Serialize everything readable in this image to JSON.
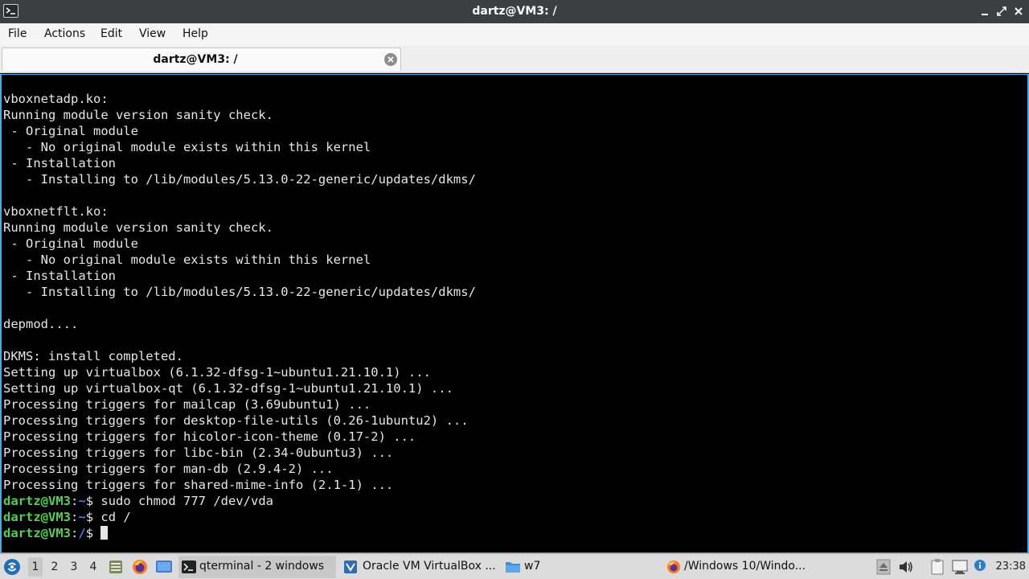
{
  "window": {
    "title": "dartz@VM3: /"
  },
  "menu": {
    "file": "File",
    "actions": "Actions",
    "edit": "Edit",
    "view": "View",
    "help": "Help"
  },
  "tab": {
    "label": "dartz@VM3: /"
  },
  "terminal": {
    "lines": [
      "vboxnetadp.ko:",
      "Running module version sanity check.",
      " - Original module",
      "   - No original module exists within this kernel",
      " - Installation",
      "   - Installing to /lib/modules/5.13.0-22-generic/updates/dkms/",
      "",
      "vboxnetflt.ko:",
      "Running module version sanity check.",
      " - Original module",
      "   - No original module exists within this kernel",
      " - Installation",
      "   - Installing to /lib/modules/5.13.0-22-generic/updates/dkms/",
      "",
      "depmod....",
      "",
      "DKMS: install completed.",
      "Setting up virtualbox (6.1.32-dfsg-1~ubuntu1.21.10.1) ...",
      "Setting up virtualbox-qt (6.1.32-dfsg-1~ubuntu1.21.10.1) ...",
      "Processing triggers for mailcap (3.69ubuntu1) ...",
      "Processing triggers for desktop-file-utils (0.26-1ubuntu2) ...",
      "Processing triggers for hicolor-icon-theme (0.17-2) ...",
      "Processing triggers for libc-bin (2.34-0ubuntu3) ...",
      "Processing triggers for man-db (2.9.4-2) ...",
      "Processing triggers for shared-mime-info (2.1-1) ..."
    ],
    "prompts": [
      {
        "user": "dartz@VM3",
        "colon": ":",
        "path": "~",
        "sym": "$ ",
        "cmd": "sudo chmod 777 /dev/vda"
      },
      {
        "user": "dartz@VM3",
        "colon": ":",
        "path": "~",
        "sym": "$ ",
        "cmd": "cd /"
      },
      {
        "user": "dartz@VM3",
        "colon": ":",
        "path": "/",
        "sym": "$ ",
        "cmd": ""
      }
    ]
  },
  "taskbar": {
    "desktops": [
      "1",
      "2",
      "3",
      "4"
    ],
    "tasks": [
      {
        "label": "qterminal - 2 windows",
        "icon": "terminal-icon"
      },
      {
        "label": "Oracle VM VirtualBox ...",
        "icon": "virtualbox-icon"
      },
      {
        "label": "w7",
        "icon": "folder-icon"
      },
      {
        "label": "/Windows 10/Windo...",
        "icon": "firefox-icon"
      }
    ],
    "clock": "23:38"
  },
  "colors": {
    "terminal_bg": "#000000",
    "terminal_fg": "#e6e6e6",
    "prompt_user": "#4fd34f",
    "prompt_path": "#4a7cff",
    "accent_border": "#3daee9",
    "titlebar_bg": "#3c3f41"
  }
}
